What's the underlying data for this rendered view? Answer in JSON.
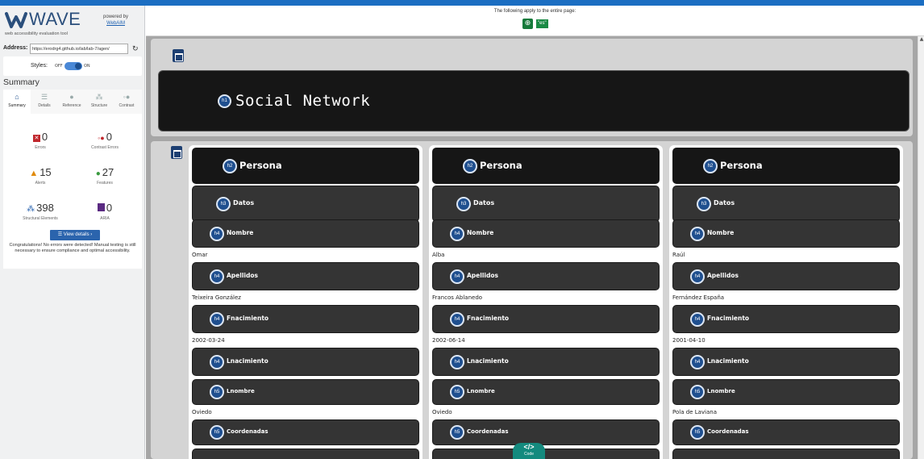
{
  "wave": {
    "logo_text": "WAVE",
    "logo_sub": "web accessibility evaluation tool",
    "powered_by": "powered by",
    "powered_link": "WebAIM",
    "address_label": "Address:",
    "address_value": "https://erodrg4.github.io/lab/lab-7/agen/",
    "styles_label": "Styles:",
    "styles_off": "OFF",
    "styles_on": "ON",
    "summary_title": "Summary",
    "tabs": [
      {
        "label": "Summary",
        "icon": "home-icon",
        "glyph": "⌂"
      },
      {
        "label": "Details",
        "icon": "list-icon",
        "glyph": "☰"
      },
      {
        "label": "Reference",
        "icon": "info-icon",
        "glyph": "●"
      },
      {
        "label": "Structure",
        "icon": "structure-icon",
        "glyph": "⁂"
      },
      {
        "label": "Contrast",
        "icon": "contrast-icon",
        "glyph": "◦●"
      }
    ],
    "stats": {
      "errors": {
        "count": "0",
        "label": "Errors"
      },
      "contrast_errors": {
        "count": "0",
        "label": "Contrast Errors"
      },
      "alerts": {
        "count": "15",
        "label": "Alerts"
      },
      "features": {
        "count": "27",
        "label": "Features"
      },
      "structural": {
        "count": "398",
        "label": "Structural Elements"
      },
      "aria": {
        "count": "0",
        "label": "ARIA"
      }
    },
    "view_details": "View details ›",
    "congrats": "Congratulations! No errors were detected! Manual testing is still necessary to ensure compliance and optimal accessibility."
  },
  "banner": {
    "text": "The following apply to the entire page:",
    "lang_badge": "\"es\""
  },
  "page": {
    "title_level": "h1",
    "title": "Social Network",
    "persons": [
      {
        "h2": "Persona",
        "h3": "Datos",
        "nombre_label": "Nombre",
        "nombre": "Omar",
        "apellidos_label": "Apellidos",
        "apellidos": "Teixeira González",
        "fnac_label": "Fnacimiento",
        "fnac": "2002-03-24",
        "lnac_label": "Lnacimiento",
        "lnombre_label": "Lnombre",
        "lnombre": "Oviedo",
        "coord_label": "Coordenadas"
      },
      {
        "h2": "Persona",
        "h3": "Datos",
        "nombre_label": "Nombre",
        "nombre": "Alba",
        "apellidos_label": "Apellidos",
        "apellidos": "Francos Ablanedo",
        "fnac_label": "Fnacimiento",
        "fnac": "2002-06-14",
        "lnac_label": "Lnacimiento",
        "lnombre_label": "Lnombre",
        "lnombre": "Oviedo",
        "coord_label": "Coordenadas"
      },
      {
        "h2": "Persona",
        "h3": "Datos",
        "nombre_label": "Nombre",
        "nombre": "Raúl",
        "apellidos_label": "Apellidos",
        "apellidos": "Fernández España",
        "fnac_label": "Fnacimiento",
        "fnac": "2001-04-10",
        "lnac_label": "Lnacimiento",
        "lnombre_label": "Lnombre",
        "lnombre": "Pola de Laviana",
        "coord_label": "Coordenadas"
      }
    ],
    "badges": {
      "h1": "h1",
      "h2": "h2",
      "h3": "h3",
      "h4": "h4",
      "h5": "h5"
    }
  },
  "code_button": {
    "glyph": "</>",
    "label": "Code"
  },
  "colors": {
    "accent": "#2b64ad",
    "error": "#c0272d",
    "alert": "#e08a0b",
    "feature": "#3a9a3f",
    "aria": "#5a2a82",
    "code": "#148a7e"
  }
}
